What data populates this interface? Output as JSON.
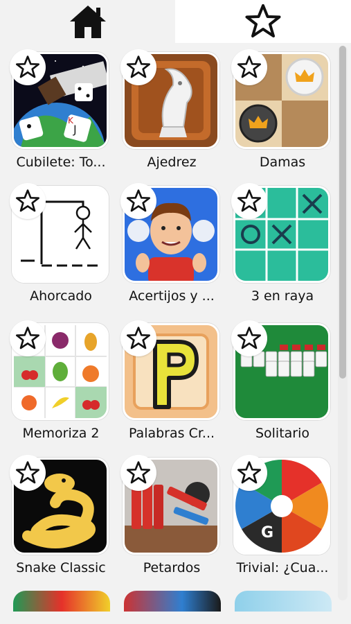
{
  "tabs": [
    {
      "icon": "home-icon",
      "active": true
    },
    {
      "icon": "star-outline-icon",
      "active": false
    }
  ],
  "games": [
    {
      "label": "Cubilete: To...",
      "icon": "dice-cup-icon"
    },
    {
      "label": "Ajedrez",
      "icon": "chess-knight-icon"
    },
    {
      "label": "Damas",
      "icon": "checkers-icon"
    },
    {
      "label": "Ahorcado",
      "icon": "hangman-icon"
    },
    {
      "label": "Acertijos y ...",
      "icon": "puzzled-boy-icon"
    },
    {
      "label": "3 en raya",
      "icon": "tic-tac-toe-icon"
    },
    {
      "label": "Memoriza 2",
      "icon": "fruit-memory-icon"
    },
    {
      "label": "Palabras Cr...",
      "icon": "letter-p-icon"
    },
    {
      "label": "Solitario",
      "icon": "solitaire-cards-icon"
    },
    {
      "label": "Snake Classic",
      "icon": "snake-icon"
    },
    {
      "label": "Petardos",
      "icon": "firecrackers-icon"
    },
    {
      "label": "Trivial: ¿Cua...",
      "icon": "trivia-wheel-icon"
    }
  ],
  "colors": {
    "accent_dark": "#111111",
    "background": "#f2f2f2",
    "tab_white": "#ffffff"
  }
}
